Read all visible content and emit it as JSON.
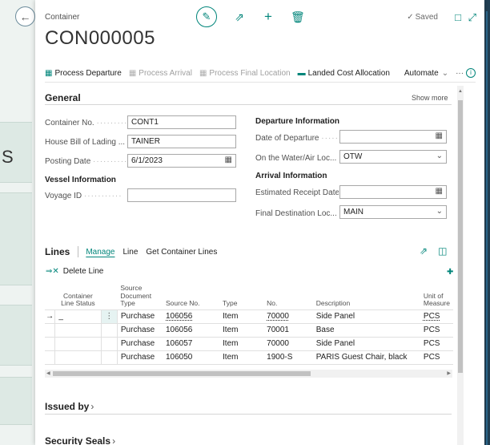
{
  "background": {
    "partial_letter": "S"
  },
  "header": {
    "caption": "Container",
    "saved_label": "Saved",
    "title": "CON000005"
  },
  "actions": [
    {
      "label": "Process Departure",
      "enabled": true
    },
    {
      "label": "Process Arrival",
      "enabled": false
    },
    {
      "label": "Process Final Location",
      "enabled": false
    },
    {
      "label": "Landed Cost Allocation",
      "enabled": true
    }
  ],
  "automate_label": "Automate",
  "more_label": "···",
  "general": {
    "title": "General",
    "show_more": "Show more",
    "container_no_label": "Container No.",
    "container_no_value": "CONT1",
    "hbl_label": "House Bill of Lading ...",
    "hbl_value": "TAINER",
    "posting_date_label": "Posting Date",
    "posting_date_value": "6/1/2023",
    "vessel_heading": "Vessel Information",
    "voyage_label": "Voyage ID",
    "voyage_value": "",
    "departure_heading": "Departure Information",
    "date_departure_label": "Date of Departure",
    "date_departure_value": "",
    "on_water_label": "On the Water/Air Loc...",
    "on_water_value": "OTW",
    "arrival_heading": "Arrival Information",
    "est_receipt_label": "Estimated Receipt Date",
    "est_receipt_value": "",
    "final_dest_label": "Final Destination Loc...",
    "final_dest_value": "MAIN"
  },
  "lines": {
    "title": "Lines",
    "tabs": [
      "Manage",
      "Line",
      "Get Container Lines"
    ],
    "delete_label": "Delete Line",
    "columns": [
      "Container Line Status",
      "Source Document Type",
      "Source No.",
      "Type",
      "No.",
      "Description",
      "Unit of Measure"
    ],
    "rows": [
      {
        "status": "_",
        "doc_type": "Purchase",
        "source_no": "106056",
        "type": "Item",
        "no": "70000",
        "description": "Side Panel",
        "uom": "PCS"
      },
      {
        "status": "",
        "doc_type": "Purchase",
        "source_no": "106056",
        "type": "Item",
        "no": "70001",
        "description": "Base",
        "uom": "PCS"
      },
      {
        "status": "",
        "doc_type": "Purchase",
        "source_no": "106057",
        "type": "Item",
        "no": "70000",
        "description": "Side Panel",
        "uom": "PCS"
      },
      {
        "status": "",
        "doc_type": "Purchase",
        "source_no": "106050",
        "type": "Item",
        "no": "1900-S",
        "description": "PARIS Guest Chair, black",
        "uom": "PCS"
      }
    ]
  },
  "fasttabs": {
    "issued_by": "Issued by",
    "security_seals": "Security Seals"
  },
  "colors": {
    "accent": "#00857a",
    "modal_backdrop": "#1d3b4f"
  }
}
